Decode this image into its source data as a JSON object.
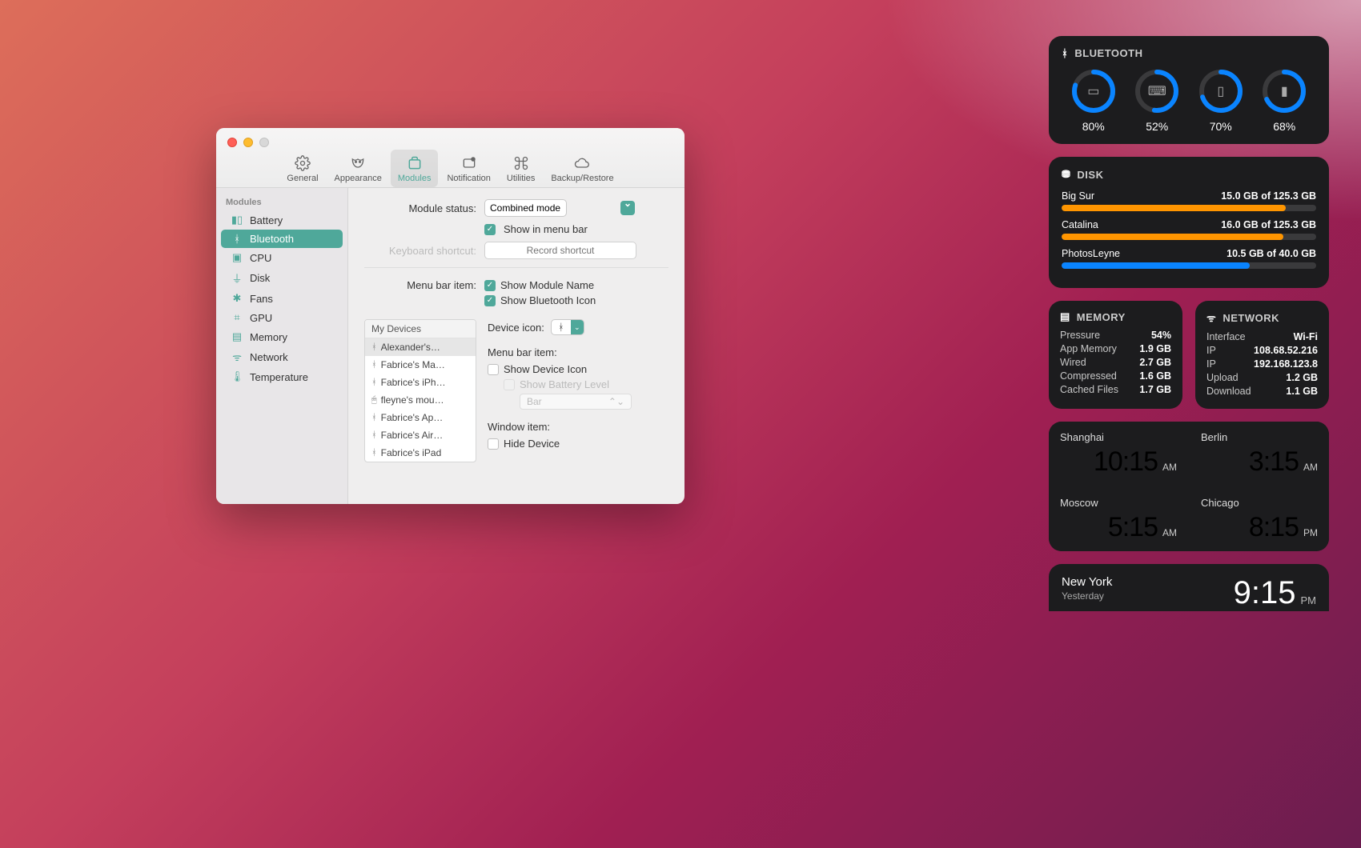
{
  "toolbar": {
    "general": "General",
    "appearance": "Appearance",
    "modules": "Modules",
    "notification": "Notification",
    "utilities": "Utilities",
    "backup": "Backup/Restore"
  },
  "sidebar": {
    "header": "Modules",
    "items": [
      {
        "label": "Battery"
      },
      {
        "label": "Bluetooth"
      },
      {
        "label": "CPU"
      },
      {
        "label": "Disk"
      },
      {
        "label": "Fans"
      },
      {
        "label": "GPU"
      },
      {
        "label": "Memory"
      },
      {
        "label": "Network"
      },
      {
        "label": "Temperature"
      }
    ]
  },
  "content": {
    "module_status_label": "Module status:",
    "module_status_value": "Combined mode",
    "show_menubar": "Show in menu bar",
    "shortcut_label": "Keyboard shortcut:",
    "shortcut_placeholder": "Record shortcut",
    "menubar_item_label": "Menu bar item:",
    "show_module_name": "Show Module Name",
    "show_bt_icon": "Show Bluetooth Icon",
    "devices_header": "My Devices",
    "devices": [
      "Alexander's…",
      "Fabrice's Ma…",
      "Fabrice's iPh…",
      "fleyne's mou…",
      "Fabrice's Ap…",
      "Fabrice's Air…",
      "Fabrice's iPad"
    ],
    "device_icon_label": "Device icon:",
    "menubar_item2": "Menu bar item:",
    "show_device_icon": "Show Device Icon",
    "show_battery_level": "Show Battery Level",
    "battery_fmt": "Bar",
    "window_item_label": "Window item:",
    "hide_device": "Hide Device"
  },
  "widgets": {
    "bluetooth": {
      "title": "BLUETOOTH",
      "items": [
        {
          "icon": "laptop",
          "pct": 80
        },
        {
          "icon": "keyboard",
          "pct": 52
        },
        {
          "icon": "phone",
          "pct": 70
        },
        {
          "icon": "tablet",
          "pct": 68
        }
      ]
    },
    "disk": {
      "title": "DISK",
      "rows": [
        {
          "name": "Big Sur",
          "used": "15.0 GB of 125.3 GB",
          "pct": 88,
          "color": "#ff9500"
        },
        {
          "name": "Catalina",
          "used": "16.0 GB of 125.3 GB",
          "pct": 87,
          "color": "#ff9500"
        },
        {
          "name": "PhotosLeyne",
          "used": "10.5 GB of 40.0 GB",
          "pct": 74,
          "color": "#0a84ff"
        }
      ]
    },
    "memory": {
      "title": "MEMORY",
      "rows": [
        {
          "k": "Pressure",
          "v": "54%"
        },
        {
          "k": "App Memory",
          "v": "1.9 GB"
        },
        {
          "k": "Wired",
          "v": "2.7 GB"
        },
        {
          "k": "Compressed",
          "v": "1.6 GB"
        },
        {
          "k": "Cached Files",
          "v": "1.7 GB"
        }
      ]
    },
    "network": {
      "title": "NETWORK",
      "rows": [
        {
          "k": "Interface",
          "v": "Wi-Fi"
        },
        {
          "k": "IP",
          "v": "108.68.52.216"
        },
        {
          "k": "IP",
          "v": "192.168.123.8"
        },
        {
          "k": "Upload",
          "v": "1.2 GB"
        },
        {
          "k": "Download",
          "v": "1.1 GB"
        }
      ]
    },
    "clocks": [
      {
        "city": "Shanghai",
        "time": "10:15",
        "ampm": "AM"
      },
      {
        "city": "Berlin",
        "time": "3:15",
        "ampm": "AM"
      },
      {
        "city": "Moscow",
        "time": "5:15",
        "ampm": "AM"
      },
      {
        "city": "Chicago",
        "time": "8:15",
        "ampm": "PM"
      }
    ],
    "weather": {
      "city": "New York",
      "sub": "Yesterday",
      "temp": "9:15",
      "pm": "PM"
    }
  }
}
